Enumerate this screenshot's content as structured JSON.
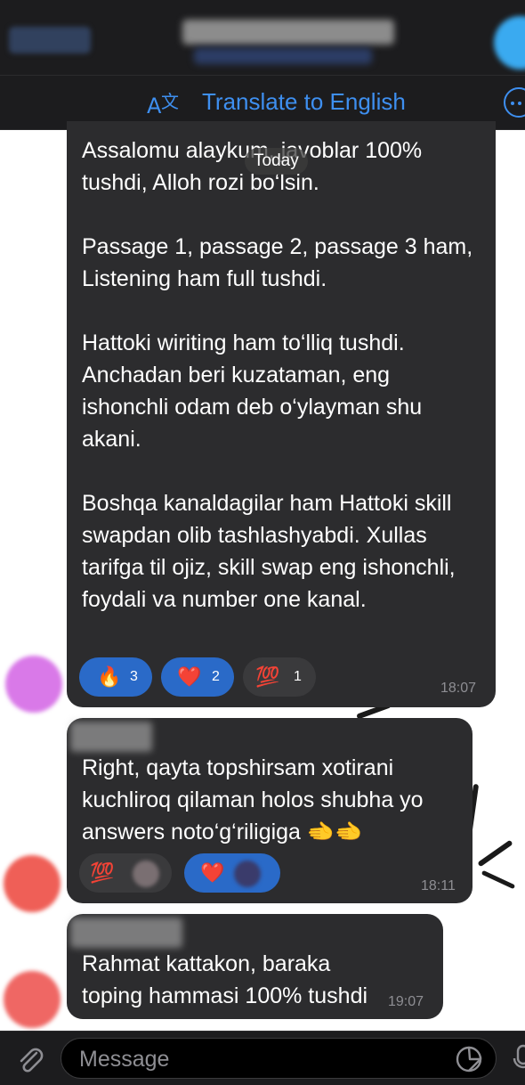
{
  "translate": {
    "label": "Translate to English"
  },
  "date_pill": "Today",
  "messages": [
    {
      "text": "Assalomu alaykum, javoblar 100% tushdi, Alloh rozi bo‘lsin.\n\nPassage 1, passage 2, passage 3 ham, Listening ham full tushdi.\n\nHattoki wiriting ham to‘lliq tushdi. Anchadan beri kuzataman, eng ishonchli odam deb o‘ylayman shu akani.\n\nBoshqa kanaldagilar ham Hattoki skill swapdan olib tashlashyabdi. Xullas tarifga til ojiz, skill swap eng ishonchli, foydali va number one kanal.",
      "time": "18:07",
      "reactions": [
        {
          "emoji": "🔥",
          "count": "3"
        },
        {
          "emoji": "❤️",
          "count": "2"
        },
        {
          "emoji": "💯",
          "count": "1"
        }
      ]
    },
    {
      "text": "Right, qayta topshirsam xotirani kuchliroq qilaman holos shubha yo answers noto‘g‘riligiga 🫲🫲",
      "time": "18:11",
      "reactions": [
        {
          "emoji": "💯"
        },
        {
          "emoji": "❤️"
        }
      ]
    },
    {
      "text": "Rahmat kattakon, baraka toping hammasi 100% tushdi",
      "time": "19:07"
    }
  ],
  "input": {
    "placeholder": "Message"
  },
  "colors": {
    "accent": "#3e8ff0",
    "bubble": "#2c2c2e",
    "reaction_selected": "#2a6ac8",
    "bar": "#1c1c1e"
  },
  "icons": [
    "back-icon",
    "translate-icon",
    "more-icon",
    "attach-icon",
    "sticker-icon",
    "microphone-icon"
  ]
}
